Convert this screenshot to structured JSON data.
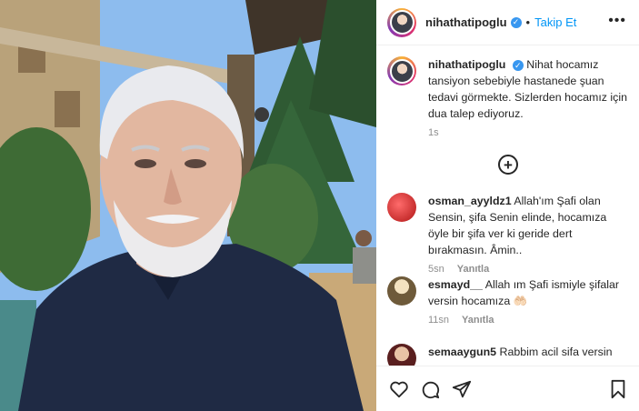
{
  "post": {
    "username": "nihathatipoglu",
    "follow_label": "Takip Et",
    "separator": "•",
    "more_label": "•••"
  },
  "caption": {
    "username": "nihathatipoglu",
    "text": "Nihat hocamız tansiyon sebebiyle hastanede şuan tedavi görmekte. Sizlerden hocamız için dua talep ediyoruz.",
    "time": "1s"
  },
  "load_more_label": "+",
  "comments": [
    {
      "username": "osman_ayyldz1",
      "text": "Allah'ım Şafi olan Sensin, şifa Senin elinde, hocamıza öyle bir şifa ver ki geride dert bırakmasın. Âmin..",
      "time": "5sn",
      "reply_label": "Yanıtla",
      "avatar_color": "#d42a2a"
    },
    {
      "username": "esmayd__",
      "text": "Allah ım Şafi ismiyle şifalar versin hocamıza 🤲🏻",
      "time": "11sn",
      "reply_label": "Yanıtla",
      "avatar_color": "#c9b27a"
    },
    {
      "username": "semaaygun5",
      "text": "Rabbim acil sifa versin",
      "time": "",
      "reply_label": "",
      "avatar_color": "#7a2d2d"
    }
  ],
  "actions": [
    "heart-icon",
    "comment-icon",
    "share-icon",
    "bookmark-icon"
  ],
  "colors": {
    "accent": "#0095f6",
    "verified": "#3897f0",
    "text": "#262626",
    "muted": "#8e8e8e"
  }
}
